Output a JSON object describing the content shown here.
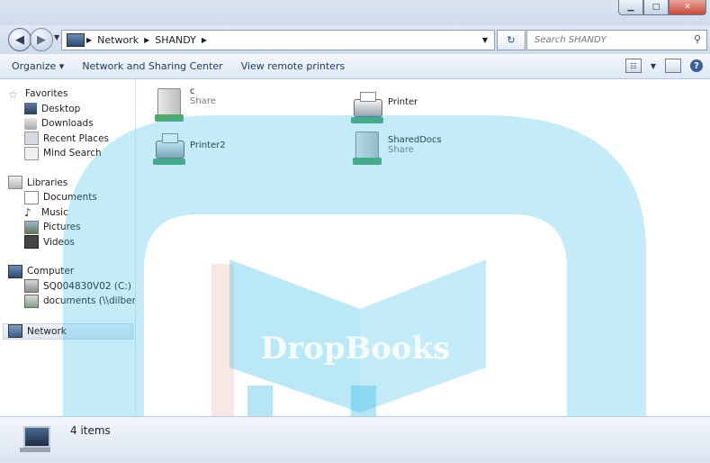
{
  "window": {
    "minimize_icon": "minimize-icon",
    "maximize_icon": "maximize-icon",
    "close_icon": "close-icon"
  },
  "address": {
    "crumbs": [
      "Network",
      "SHANDY"
    ],
    "search_placeholder": "Search SHANDY"
  },
  "toolbar": {
    "organize": "Organize ▾",
    "network_sharing": "Network and Sharing Center",
    "view_printers": "View remote printers"
  },
  "sidebar": {
    "favorites": {
      "header": "Favorites",
      "items": [
        "Desktop",
        "Downloads",
        "Recent Places",
        "Mind Search"
      ]
    },
    "libraries": {
      "header": "Libraries",
      "items": [
        "Documents",
        "Music",
        "Pictures",
        "Videos"
      ]
    },
    "computer": {
      "header": "Computer",
      "items": [
        "SQ004830V02 (C:)",
        "documents (\\\\dilbert"
      ]
    },
    "network": {
      "header": "Network"
    }
  },
  "items": [
    {
      "name": "c",
      "sub": "Share",
      "kind": "folder"
    },
    {
      "name": "Printer",
      "sub": "",
      "kind": "printer"
    },
    {
      "name": "Printer2",
      "sub": "",
      "kind": "printer"
    },
    {
      "name": "SharedDocs",
      "sub": "Share",
      "kind": "folder"
    }
  ],
  "status": {
    "count": "4 items"
  },
  "watermark": {
    "text": "DropBooks"
  },
  "colors": {
    "accent": "#3a7bd5",
    "watermark_blue": "#29b6e6",
    "watermark_red": "#c0392b"
  }
}
